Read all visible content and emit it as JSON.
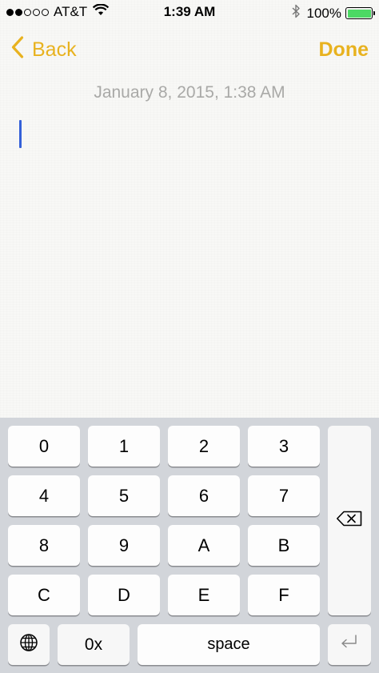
{
  "status_bar": {
    "carrier": "AT&T",
    "signal_dots_filled": 2,
    "signal_dots_total": 5,
    "time": "1:39 AM",
    "battery_percent": "100%",
    "battery_level": 1.0,
    "battery_color": "#4cd964",
    "wifi_icon": "wifi-icon",
    "bluetooth_icon": "bluetooth-icon"
  },
  "nav": {
    "back_label": "Back",
    "done_label": "Done",
    "accent_color": "#e8b21f"
  },
  "note": {
    "date": "January 8, 2015, 1:38 AM",
    "body": ""
  },
  "keyboard": {
    "row1": [
      "0",
      "1",
      "2",
      "3"
    ],
    "row2": [
      "4",
      "5",
      "6",
      "7"
    ],
    "row3": [
      "8",
      "9",
      "A",
      "B"
    ],
    "row4": [
      "C",
      "D",
      "E",
      "F"
    ],
    "hex_prefix": "0x",
    "space_label": "space",
    "globe_icon": "globe-icon",
    "delete_icon": "delete-icon",
    "return_icon": "return-icon"
  }
}
